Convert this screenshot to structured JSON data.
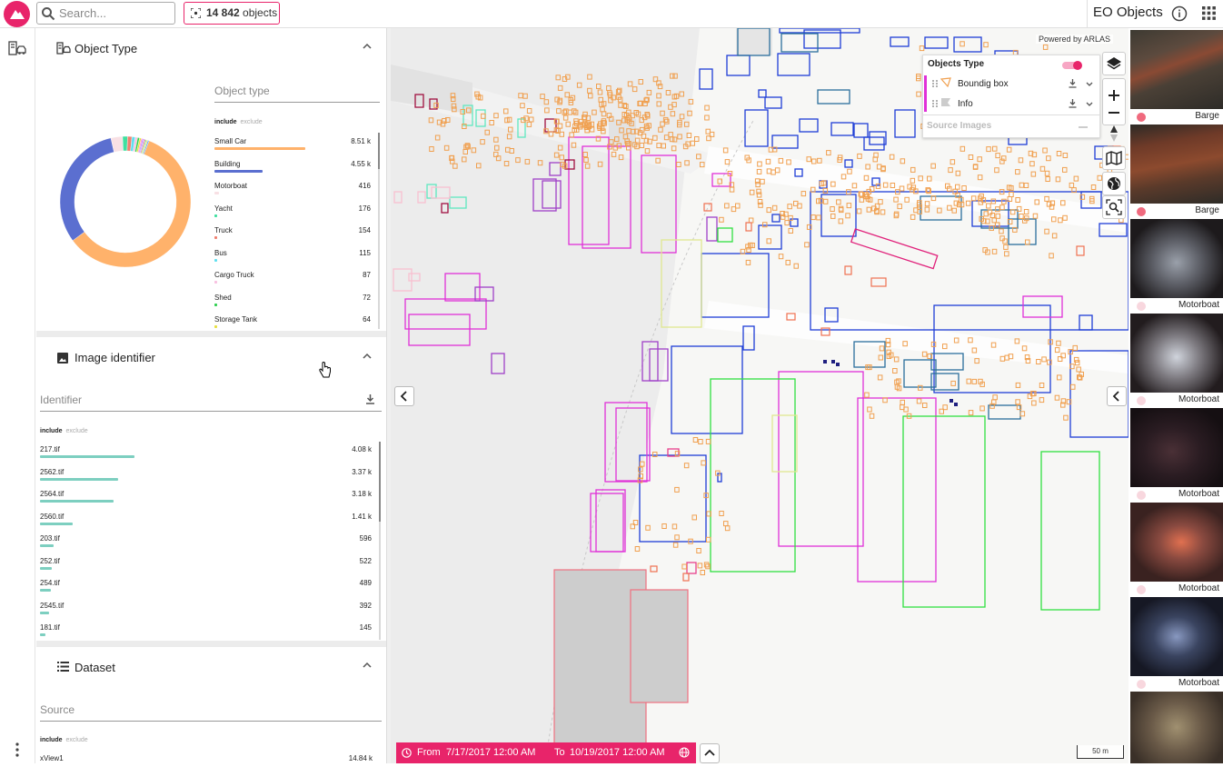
{
  "topbar": {
    "search_placeholder": "Search...",
    "count": "14 842",
    "count_unit": "objects",
    "title": "EO Objects"
  },
  "colors": {
    "accent": "#e8246a",
    "small_car": "#ffb26b",
    "building": "#1e3ed6",
    "image_bar": "#7dcfc0",
    "barge_dot": "#f06a7e",
    "motorboat_dot": "#f8d7de"
  },
  "object_type": {
    "title": "Object Type",
    "field_placeholder": "Object type",
    "include": "include",
    "exclude": "exclude",
    "items": [
      {
        "label": "Small Car",
        "count": "8.51 k",
        "value": 8510,
        "color": "#ffb26b"
      },
      {
        "label": "Building",
        "count": "4.55 k",
        "value": 4550,
        "color": "#5b6fd0"
      },
      {
        "label": "Motorboat",
        "count": "416",
        "value": 416,
        "color": "#f8e0e4"
      },
      {
        "label": "Yacht",
        "count": "176",
        "value": 176,
        "color": "#40e0a0"
      },
      {
        "label": "Truck",
        "count": "154",
        "value": 154,
        "color": "#f08070"
      },
      {
        "label": "Bus",
        "count": "115",
        "value": 115,
        "color": "#60e0f0"
      },
      {
        "label": "Cargo Truck",
        "count": "87",
        "value": 87,
        "color": "#f8c0e0"
      },
      {
        "label": "Shed",
        "count": "72",
        "value": 72,
        "color": "#30d050"
      },
      {
        "label": "Storage Tank",
        "count": "64",
        "value": 64,
        "color": "#e8e040"
      }
    ]
  },
  "image_identifier": {
    "title": "Image identifier",
    "field_placeholder": "Identifier",
    "include": "include",
    "exclude": "exclude",
    "items": [
      {
        "label": "217.tif",
        "count": "4.08 k",
        "value": 4080
      },
      {
        "label": "2562.tif",
        "count": "3.37 k",
        "value": 3370
      },
      {
        "label": "2564.tif",
        "count": "3.18 k",
        "value": 3180
      },
      {
        "label": "2560.tif",
        "count": "1.41 k",
        "value": 1410
      },
      {
        "label": "203.tif",
        "count": "596",
        "value": 596
      },
      {
        "label": "252.tif",
        "count": "522",
        "value": 522
      },
      {
        "label": "254.tif",
        "count": "489",
        "value": 489
      },
      {
        "label": "2545.tif",
        "count": "392",
        "value": 392
      },
      {
        "label": "181.tif",
        "count": "145",
        "value": 145
      }
    ]
  },
  "dataset": {
    "title": "Dataset",
    "field_placeholder": "Source",
    "include": "include",
    "exclude": "exclude",
    "items": [
      {
        "label": "xView1",
        "count": "14.84 k"
      }
    ]
  },
  "map": {
    "powered_by": "Powered by ARLAS",
    "layer_panel": {
      "group": "Objects Type",
      "layers": [
        "Boundig box",
        "Info"
      ],
      "collapsed_group": "Source Images"
    },
    "scale": "50 m",
    "time_from_label": "From",
    "time_from": "7/17/2017 12:00 AM",
    "time_to_label": "To",
    "time_to": "10/19/2017 12:00 AM"
  },
  "thumbnails": [
    {
      "label": "Barge",
      "dot": "#f06a7e"
    },
    {
      "label": "Barge",
      "dot": "#f06a7e"
    },
    {
      "label": "Motorboat",
      "dot": "#f8d7de"
    },
    {
      "label": "Motorboat",
      "dot": "#f8d7de"
    },
    {
      "label": "Motorboat",
      "dot": "#f8d7de"
    },
    {
      "label": "Motorboat",
      "dot": "#f8d7de"
    },
    {
      "label": "Motorboat",
      "dot": "#f8d7de"
    },
    {
      "label": "",
      "dot": "#f06a7e"
    }
  ]
}
